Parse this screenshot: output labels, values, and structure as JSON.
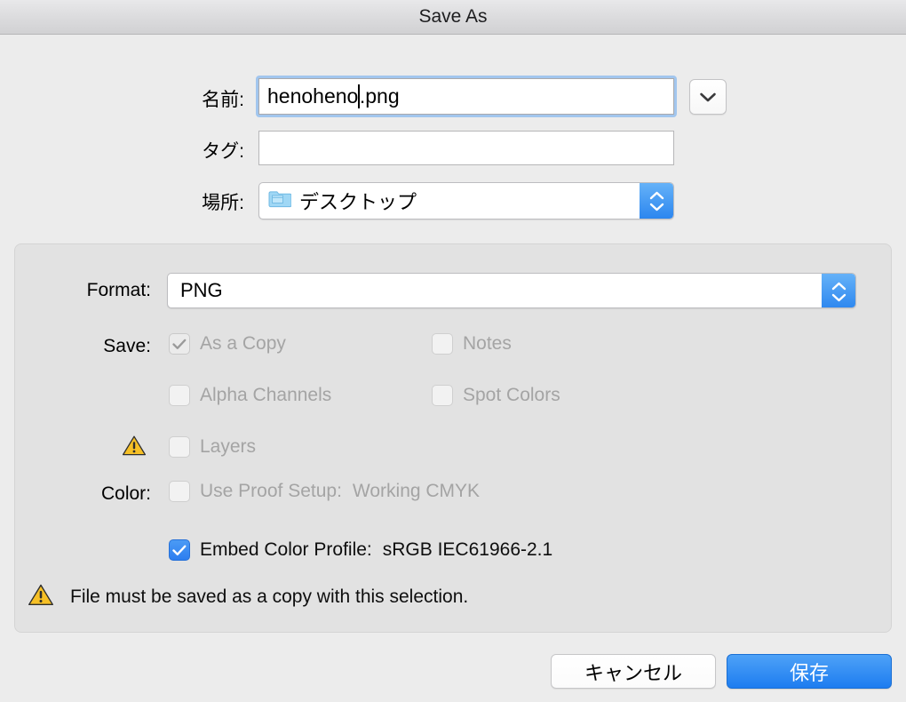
{
  "window": {
    "title": "Save As"
  },
  "form": {
    "name": {
      "label": "名前:",
      "value_before_caret": "henoheno",
      "value_after_caret": ".png",
      "full_value": "henoheno.png"
    },
    "tags": {
      "label": "タグ:",
      "value": "",
      "placeholder": ""
    },
    "location": {
      "label": "場所:",
      "value": "デスクトップ",
      "icon": "folder-icon"
    },
    "disclosure_icon": "chevron-down-icon"
  },
  "options": {
    "format": {
      "label": "Format:",
      "value": "PNG"
    },
    "save": {
      "label": "Save:",
      "items": [
        {
          "label": "As a Copy",
          "checked": true,
          "disabled": true
        },
        {
          "label": "Notes",
          "checked": false,
          "disabled": true
        },
        {
          "label": "Alpha Channels",
          "checked": false,
          "disabled": true
        },
        {
          "label": "Spot Colors",
          "checked": false,
          "disabled": true
        },
        {
          "label": "Layers",
          "checked": false,
          "disabled": true,
          "warning_icon": "warning-triangle-icon"
        }
      ]
    },
    "color": {
      "label": "Color:",
      "items": [
        {
          "label": "Use Proof Setup:",
          "value": "Working CMYK",
          "checked": false,
          "disabled": true
        },
        {
          "label": "Embed Color Profile:",
          "value": "sRGB IEC61966-2.1",
          "checked": true,
          "disabled": false
        }
      ]
    },
    "warning": {
      "icon": "warning-triangle-icon",
      "text": "File must be saved as a copy with this selection."
    }
  },
  "footer": {
    "cancel_label": "キャンセル",
    "save_label": "保存"
  },
  "colors": {
    "accent": "#2c7ef0",
    "warning": "#f2b50c",
    "window_bg": "#ececec",
    "panel_bg": "#e2e2e2",
    "focus_ring": "#a2c6ee"
  }
}
